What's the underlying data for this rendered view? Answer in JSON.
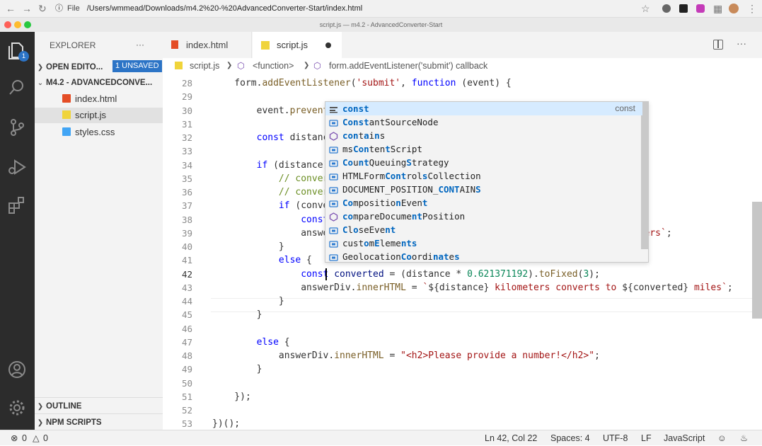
{
  "browser": {
    "scheme_label": "File",
    "url": "/Users/wmmead/Downloads/m4.2%20-%20AdvancedConverter-Start/index.html"
  },
  "window": {
    "title": "script.js — m4.2 - AdvancedConverter-Start"
  },
  "activity_bar": {
    "explorer_badge": "1"
  },
  "sidebar": {
    "header": "EXPLORER",
    "more": "···",
    "open_editors": {
      "label": "OPEN EDITO...",
      "badge": "1 UNSAVED"
    },
    "folder": "M4.2 - ADVANCEDCONVE...",
    "files": [
      {
        "name": "index.html",
        "icon": "html5-icon"
      },
      {
        "name": "script.js",
        "icon": "js-icon"
      },
      {
        "name": "styles.css",
        "icon": "css3-icon"
      }
    ],
    "outline": "OUTLINE",
    "npm_scripts": "NPM SCRIPTS"
  },
  "tabs": [
    {
      "label": "index.html",
      "active": false,
      "dirty": false
    },
    {
      "label": "script.js",
      "active": true,
      "dirty": true
    }
  ],
  "breadcrumbs": {
    "file": "script.js",
    "scope1": "<function>",
    "scope2": "form.addEventListener('submit') callback"
  },
  "code": {
    "current_line": "42",
    "lines": [
      {
        "n": "28",
        "segs": [
          [
            "",
            "    form."
          ],
          [
            "fn",
            "addEventListener"
          ],
          [
            "",
            "("
          ],
          [
            "st",
            "'submit'"
          ],
          [
            "",
            ", "
          ],
          [
            "kw",
            "function"
          ],
          [
            "",
            " (event) {"
          ]
        ]
      },
      {
        "n": "29",
        "segs": []
      },
      {
        "n": "30",
        "segs": [
          [
            "",
            "        event."
          ],
          [
            "fn",
            "prevent"
          ]
        ]
      },
      {
        "n": "31",
        "segs": []
      },
      {
        "n": "32",
        "segs": [
          [
            "",
            "        "
          ],
          [
            "kw",
            "const"
          ],
          [
            "",
            " distanc"
          ]
        ]
      },
      {
        "n": "33",
        "segs": []
      },
      {
        "n": "34",
        "segs": [
          [
            "",
            "        "
          ],
          [
            "kw",
            "if"
          ],
          [
            "",
            " (distance)"
          ]
        ]
      },
      {
        "n": "35",
        "segs": [
          [
            "",
            "            "
          ],
          [
            "cm",
            "// conver"
          ]
        ]
      },
      {
        "n": "36",
        "segs": [
          [
            "",
            "            "
          ],
          [
            "cm",
            "// conver"
          ]
        ]
      },
      {
        "n": "37",
        "segs": [
          [
            "",
            "            "
          ],
          [
            "kw",
            "if"
          ],
          [
            "",
            " (conve"
          ]
        ]
      },
      {
        "n": "38",
        "segs": [
          [
            "",
            "                "
          ],
          [
            "kw",
            "const"
          ]
        ]
      },
      {
        "n": "39",
        "segs": [
          [
            "",
            "                answe"
          ],
          [
            "",
            "                                                  "
          ],
          [
            "st",
            "kilometers`"
          ],
          [
            "",
            ";"
          ]
        ]
      },
      {
        "n": "40",
        "segs": [
          [
            "",
            "            }"
          ]
        ]
      },
      {
        "n": "41",
        "segs": [
          [
            "",
            "            "
          ],
          [
            "kw",
            "else"
          ],
          [
            "",
            " {"
          ]
        ]
      },
      {
        "n": "42",
        "segs": [
          [
            "",
            "                "
          ],
          [
            "kw",
            "const"
          ],
          [
            "",
            " "
          ],
          [
            "vr",
            "converted"
          ],
          [
            "",
            " = (distance * "
          ],
          [
            "nm",
            "0.621371192"
          ],
          [
            "",
            ")."
          ],
          [
            "fn",
            "toFixed"
          ],
          [
            "",
            "("
          ],
          [
            "nm",
            "3"
          ],
          [
            "",
            ");"
          ]
        ]
      },
      {
        "n": "43",
        "segs": [
          [
            "",
            "                answerDiv."
          ],
          [
            "fn",
            "innerHTML"
          ],
          [
            "",
            " = "
          ],
          [
            "st",
            "`"
          ],
          [
            "",
            "${distance}"
          ],
          [
            "st",
            " kilometers converts to "
          ],
          [
            "",
            "${converted}"
          ],
          [
            "st",
            " miles`"
          ],
          [
            "",
            ";"
          ]
        ]
      },
      {
        "n": "44",
        "segs": [
          [
            "",
            "            }"
          ]
        ]
      },
      {
        "n": "45",
        "segs": [
          [
            "",
            "        }"
          ]
        ]
      },
      {
        "n": "46",
        "segs": []
      },
      {
        "n": "47",
        "segs": [
          [
            "",
            "        "
          ],
          [
            "kw",
            "else"
          ],
          [
            "",
            " {"
          ]
        ]
      },
      {
        "n": "48",
        "segs": [
          [
            "",
            "            answerDiv."
          ],
          [
            "fn",
            "innerHTML"
          ],
          [
            "",
            " = "
          ],
          [
            "st",
            "\"<h2>Please provide a number!</h2>\""
          ],
          [
            "",
            ";"
          ]
        ]
      },
      {
        "n": "49",
        "segs": [
          [
            "",
            "        }"
          ]
        ]
      },
      {
        "n": "50",
        "segs": []
      },
      {
        "n": "51",
        "segs": [
          [
            "",
            "    });"
          ]
        ]
      },
      {
        "n": "52",
        "segs": []
      },
      {
        "n": "53",
        "segs": [
          [
            "",
            "})();"
          ]
        ]
      }
    ]
  },
  "suggestions": {
    "selected_detail": "const",
    "items": [
      {
        "icon": "keyword-icon",
        "parts": [
          [
            "b",
            "const"
          ]
        ]
      },
      {
        "icon": "variable-icon",
        "parts": [
          [
            "b",
            "Const"
          ],
          [
            "",
            "antSourceNode"
          ]
        ]
      },
      {
        "icon": "method-icon",
        "parts": [
          [
            "b",
            "con"
          ],
          [
            "",
            "t"
          ],
          [
            "b",
            "a"
          ],
          [
            "",
            "i"
          ],
          [
            "b",
            "n"
          ],
          [
            "",
            "s"
          ]
        ]
      },
      {
        "icon": "variable-icon",
        "parts": [
          [
            "",
            "ms"
          ],
          [
            "b",
            "Con"
          ],
          [
            "",
            "ten"
          ],
          [
            "b",
            "t"
          ],
          [
            "",
            "Script"
          ]
        ]
      },
      {
        "icon": "variable-icon",
        "parts": [
          [
            "b",
            "Co"
          ],
          [
            "",
            "u"
          ],
          [
            "b",
            "nt"
          ],
          [
            "",
            "Queuing"
          ],
          [
            "b",
            "S"
          ],
          [
            "",
            "trategy"
          ]
        ]
      },
      {
        "icon": "variable-icon",
        "parts": [
          [
            "",
            "HTMLForm"
          ],
          [
            "b",
            "Cont"
          ],
          [
            "",
            "rol"
          ],
          [
            "b",
            "s"
          ],
          [
            "",
            "Collection"
          ]
        ]
      },
      {
        "icon": "property-icon",
        "parts": [
          [
            "",
            "DOCUMENT_POSITION_"
          ],
          [
            "b",
            "CONT"
          ],
          [
            "",
            "AIN"
          ],
          [
            "b",
            "S"
          ]
        ]
      },
      {
        "icon": "variable-icon",
        "parts": [
          [
            "b",
            "Co"
          ],
          [
            "",
            "mpositio"
          ],
          [
            "b",
            "n"
          ],
          [
            "",
            "Even"
          ],
          [
            "b",
            "t"
          ]
        ]
      },
      {
        "icon": "method-icon",
        "parts": [
          [
            "b",
            "co"
          ],
          [
            "",
            "mpareDocume"
          ],
          [
            "b",
            "nt"
          ],
          [
            "",
            "Position"
          ]
        ]
      },
      {
        "icon": "variable-icon",
        "parts": [
          [
            "b",
            "C"
          ],
          [
            "",
            "l"
          ],
          [
            "b",
            "o"
          ],
          [
            "",
            "seEve"
          ],
          [
            "b",
            "nt"
          ]
        ]
      },
      {
        "icon": "variable-icon",
        "parts": [
          [
            "",
            "cust"
          ],
          [
            "b",
            "o"
          ],
          [
            "",
            "m"
          ],
          [
            "b",
            "E"
          ],
          [
            "",
            "leme"
          ],
          [
            "b",
            "nts"
          ]
        ]
      },
      {
        "icon": "variable-icon",
        "parts": [
          [
            "",
            "Geolocation"
          ],
          [
            "b",
            "Co"
          ],
          [
            "",
            "ordi"
          ],
          [
            "b",
            "nat"
          ],
          [
            "",
            "e"
          ],
          [
            "b",
            "s"
          ]
        ]
      }
    ]
  },
  "status": {
    "errors": "0",
    "warnings": "0",
    "position": "Ln 42, Col 22",
    "spaces": "Spaces: 4",
    "encoding": "UTF-8",
    "eol": "LF",
    "language": "JavaScript"
  },
  "colors": {
    "activity_bar": "#2c2c2c",
    "sidebar": "#f3f3f3",
    "badge": "#2c74c6",
    "keyword": "#0000ff",
    "string": "#a31515",
    "function": "#795e26",
    "number": "#098658",
    "comment": "#6b8e23"
  }
}
